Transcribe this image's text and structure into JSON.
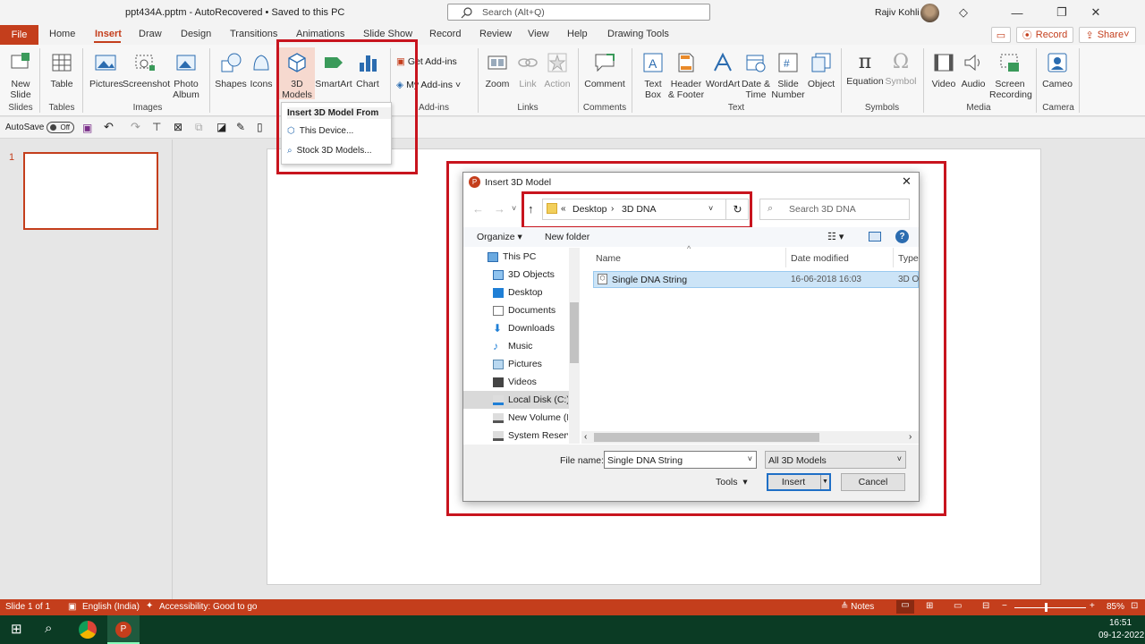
{
  "titlebar": {
    "title": "ppt434A.pptm  -  AutoRecovered  •  Saved to this PC",
    "search_placeholder": "Search (Alt+Q)",
    "user": "Rajiv Kohli"
  },
  "tabs": {
    "file": "File",
    "items": [
      "Home",
      "Insert",
      "Draw",
      "Design",
      "Transitions",
      "Animations",
      "Slide Show",
      "Record",
      "Review",
      "View",
      "Help",
      "Drawing Tools"
    ],
    "record_btn": "Record",
    "share_btn": "Share"
  },
  "ribbon": {
    "new_slide": "New\nSlide",
    "table": "Table",
    "pictures": "Pictures",
    "screenshot": "Screenshot",
    "photo_album": "Photo\nAlbum",
    "shapes": "Shapes",
    "icons": "Icons",
    "models3d": "3D\nModels",
    "smartart": "SmartArt",
    "chart": "Chart",
    "get_addins": "Get Add-ins",
    "my_addins": "My Add-ins",
    "zoom": "Zoom",
    "link": "Link",
    "action": "Action",
    "comment": "Comment",
    "text_box": "Text\nBox",
    "header_footer": "Header\n& Footer",
    "wordart": "WordArt",
    "date_time": "Date &\nTime",
    "slide_number": "Slide\nNumber",
    "object": "Object",
    "equation": "Equation",
    "symbol": "Symbol",
    "video": "Video",
    "audio": "Audio",
    "screen_recording": "Screen\nRecording",
    "cameo": "Cameo",
    "groups": {
      "slides": "Slides",
      "tables": "Tables",
      "images": "Images",
      "addins": "Add-ins",
      "links": "Links",
      "comments": "Comments",
      "text": "Text",
      "symbols": "Symbols",
      "media": "Media",
      "camera": "Camera"
    }
  },
  "qat": {
    "autosave": "AutoSave",
    "toggle": "Off"
  },
  "slides": {
    "number": "1"
  },
  "dropdown": {
    "header": "Insert 3D Model From",
    "this_device": "This Device...",
    "stock": "Stock 3D Models..."
  },
  "dialog": {
    "title": "Insert 3D Model",
    "breadcrumb": [
      "Desktop",
      "3D DNA"
    ],
    "search_placeholder": "Search 3D DNA",
    "organize": "Organize",
    "new_folder": "New folder",
    "nav": [
      "This PC",
      "3D Objects",
      "Desktop",
      "Documents",
      "Downloads",
      "Music",
      "Pictures",
      "Videos",
      "Local Disk (C:)",
      "New Volume (D:)",
      "System Reserved"
    ],
    "columns": {
      "name": "Name",
      "date": "Date modified",
      "type": "Type"
    },
    "file": {
      "name": "Single DNA String",
      "date": "16-06-2018 16:03",
      "type": "3D O"
    },
    "file_name_label": "File name:",
    "file_name_value": "Single DNA String",
    "filter": "All 3D Models",
    "tools": "Tools",
    "insert": "Insert",
    "cancel": "Cancel"
  },
  "status": {
    "slide": "Slide 1 of 1",
    "language": "English (India)",
    "accessibility": "Accessibility: Good to go",
    "notes": "Notes",
    "zoom": "85%"
  },
  "taskbar": {
    "time": "16:51",
    "date": "09-12-2022"
  }
}
